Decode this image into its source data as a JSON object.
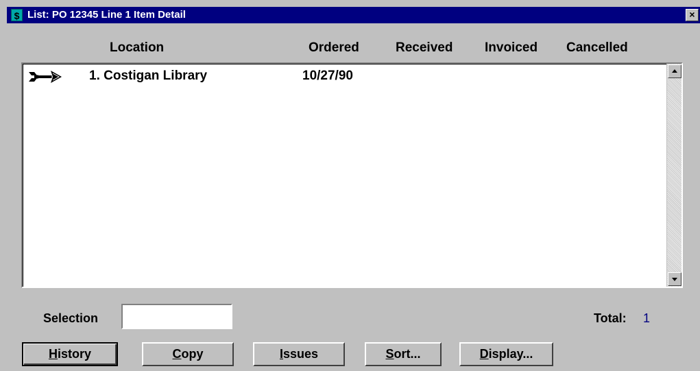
{
  "window": {
    "title": "List: PO 12345 Line 1 Item Detail",
    "icon_glyph": "$",
    "close_glyph": "×"
  },
  "columns": [
    "Location",
    "Ordered",
    "Received",
    "Invoiced",
    "Cancelled"
  ],
  "rows": [
    {
      "location": "1. Costigan Library",
      "ordered": "10/27/90",
      "received": "",
      "invoiced": "",
      "cancelled": "",
      "selected_indicator": "arrow-pointer-icon"
    }
  ],
  "selection": {
    "label": "Selection",
    "value": ""
  },
  "total": {
    "label": "Total:",
    "value": "1"
  },
  "buttons": [
    {
      "mnemonic": "H",
      "rest": "istory"
    },
    {
      "mnemonic": "C",
      "rest": "opy"
    },
    {
      "mnemonic": "I",
      "rest": "ssues"
    },
    {
      "mnemonic": "S",
      "rest": "ort..."
    },
    {
      "mnemonic": "D",
      "rest": "isplay..."
    }
  ],
  "colors": {
    "titlebar": "#000080",
    "face": "#c0c0c0",
    "total_value": "#000080"
  }
}
